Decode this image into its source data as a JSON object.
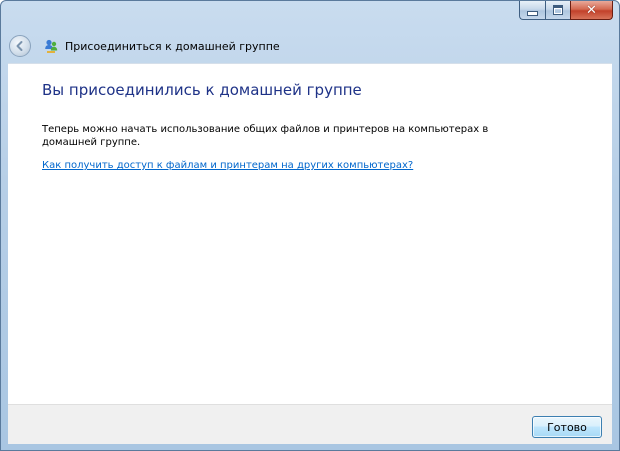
{
  "window": {
    "title": "Присоединиться к домашней группе",
    "caption_buttons": {
      "minimize_icon": "minimize-icon",
      "maximize_icon": "maximize-icon",
      "close_icon": "close-icon",
      "close_glyph": "✕"
    },
    "back_icon": "back-arrow-icon",
    "app_icon": "homegroup-icon"
  },
  "main": {
    "heading": "Вы присоединились к домашней группе",
    "description": "Теперь можно начать использование общих файлов и принтеров на компьютерах в домашней группе.",
    "help_link": "Как получить доступ к файлам и принтерам на других компьютерах?"
  },
  "footer": {
    "done_label": "Готово"
  },
  "colors": {
    "heading": "#1e3287",
    "link": "#0066cc",
    "frame": "#b7cfe7",
    "close_button": "#c2412a"
  }
}
